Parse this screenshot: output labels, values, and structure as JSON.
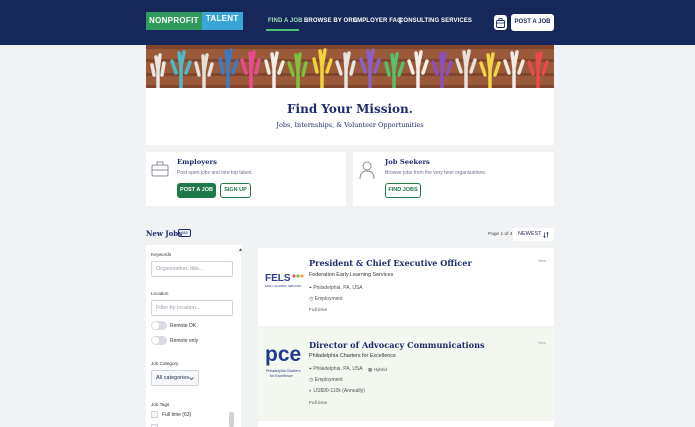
{
  "header": {
    "logo_part1": "NONPROFIT",
    "logo_part2": "TALENT",
    "nav": [
      "FIND A JOB",
      "BROWSE BY ORG",
      "EMPLOYER FAQ",
      "CONSULTING SERVICES"
    ],
    "post_job": "POST A JOB",
    "accent_color": "#4dc07a",
    "bg_color": "#16285a"
  },
  "hero": {
    "title": "Find Your Mission.",
    "subtitle": "Jobs, Internships, & Volunteer Opportunities"
  },
  "employers": {
    "title": "Employers",
    "desc": "Post open jobs and hire top talent.",
    "post_button": "POST A JOB",
    "signup_button": "SIGN UP"
  },
  "seekers": {
    "title": "Job Seekers",
    "desc": "Browse jobs from the very best organizations.",
    "find_button": "FIND JOBS"
  },
  "jobs": {
    "title": "New Jobs",
    "count": "185",
    "page_info": "Page 1 of 4",
    "sort": "NEWEST"
  },
  "filters": {
    "keywords_label": "Keywords",
    "keywords_placeholder": "Organization, title...",
    "location_label": "Location",
    "location_placeholder": "Filter by location...",
    "remote_ok": "Remote OK",
    "remote_only": "Remote only",
    "category_label": "Job Category",
    "category_value": "All categories",
    "tags_label": "Job Tags",
    "tag_fulltime": "Full time (63)"
  },
  "listings": [
    {
      "title": "President & Chief Executive Officer",
      "org": "Federation Early Learning Services",
      "location": "Philadelphia, PA, USA",
      "type": "Employment",
      "tag": "Full time",
      "badge": "New",
      "logo_text": "FELS",
      "logo_sub": "EARLY LEARNING SERVICES"
    },
    {
      "title": "Director of Advocacy Communications",
      "org": "Philadelphia Charters for Excellence",
      "location": "Philadelphia, PA, USA",
      "hybrid": "Hybrid",
      "type": "Employment",
      "salary": "US$90-110k (Annually)",
      "tag": "Full time",
      "badge": "New",
      "logo_text": "pce",
      "logo_sub1": "Philadelphia Charters",
      "logo_sub2": "for Excellence"
    }
  ]
}
